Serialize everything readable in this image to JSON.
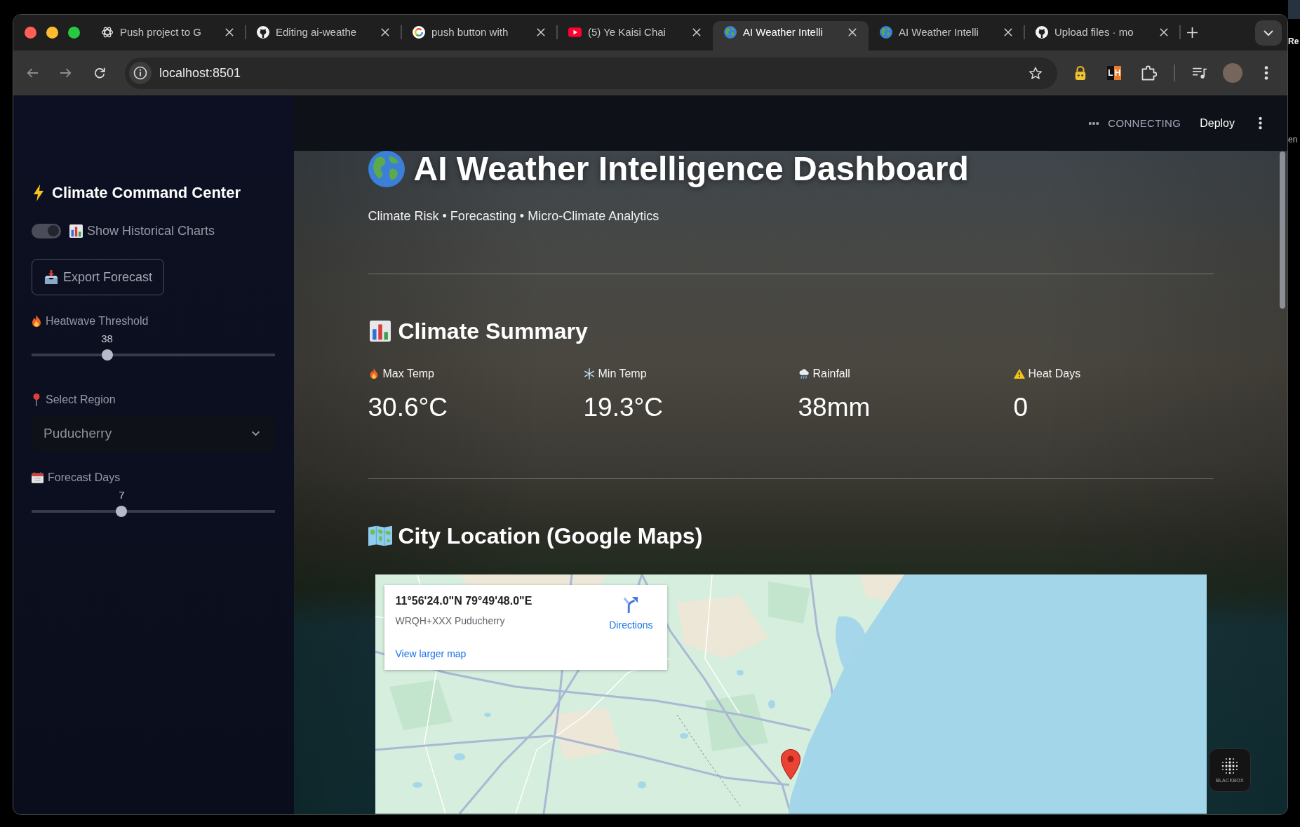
{
  "browser": {
    "tabs": [
      {
        "title": "Push project to G",
        "kind": "chat",
        "selected": false
      },
      {
        "title": "Editing ai-weathe",
        "kind": "repo",
        "selected": false
      },
      {
        "title": "push button with",
        "kind": "search",
        "selected": false
      },
      {
        "title": "(5) Ye Kaisi Chai",
        "kind": "video",
        "selected": false
      },
      {
        "title": "AI Weather Intelli",
        "kind": "app",
        "selected": true
      },
      {
        "title": "AI Weather Intelli",
        "kind": "app",
        "selected": false
      },
      {
        "title": "Upload files · mo",
        "kind": "repo",
        "selected": false
      }
    ],
    "address": "localhost:8501",
    "extensions": [
      {
        "kind": "lock"
      },
      {
        "kind": "letters",
        "letters": [
          "L",
          "H"
        ]
      },
      {
        "kind": "puzzle"
      }
    ]
  },
  "sidebar": {
    "title": "Climate Command Center",
    "controls": [
      {
        "kind": "toggle",
        "label": "Show Historical Charts",
        "on": true
      },
      {
        "kind": "button",
        "label": "Export Forecast"
      },
      {
        "kind": "slider",
        "label": "Heatwave Threshold",
        "value": "38",
        "level": 0.31
      },
      {
        "kind": "select",
        "label": "Select Region",
        "value": "Puducherry"
      },
      {
        "kind": "slider",
        "label": "Forecast Days",
        "value": "7",
        "level": 0.37
      }
    ]
  },
  "app_header": {
    "status": "CONNECTING",
    "deploy": "Deploy"
  },
  "main": {
    "title": "AI Weather Intelligence Dashboard",
    "subtitle": "Climate Risk • Forecasting • Micro-Climate Analytics",
    "summary": {
      "heading": "Climate Summary",
      "metrics": [
        {
          "label": "Max Temp",
          "value": "30.6°C"
        },
        {
          "label": "Min Temp",
          "value": "19.3°C"
        },
        {
          "label": "Rainfall",
          "value": "38mm"
        },
        {
          "label": "Heat Days",
          "value": "0"
        }
      ]
    },
    "location": {
      "heading": "City Location (Google Maps)",
      "map": {
        "coordinates": "11°56'24.0\"N 79°49'48.0\"E",
        "plus_code": "WRQH+XXX Puducherry",
        "link": "View larger map",
        "directions": "Directions"
      }
    }
  },
  "widget": {
    "label": "BLACKBOX"
  },
  "backdrop": {
    "texts": [
      "Re",
      "en"
    ]
  }
}
